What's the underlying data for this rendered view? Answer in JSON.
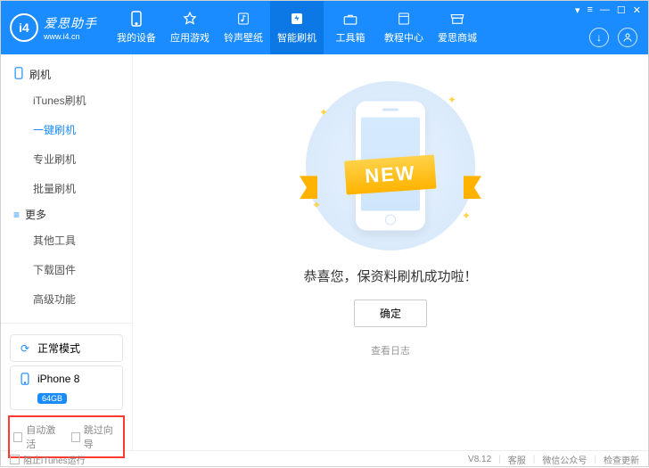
{
  "header": {
    "logo_ch": "爱思助手",
    "logo_en": "www.i4.cn",
    "logo_mark": "i4",
    "nav": [
      {
        "label": "我的设备",
        "icon": "phone"
      },
      {
        "label": "应用游戏",
        "icon": "apps"
      },
      {
        "label": "铃声壁纸",
        "icon": "music"
      },
      {
        "label": "智能刷机",
        "icon": "flash",
        "active": true
      },
      {
        "label": "工具箱",
        "icon": "tools"
      },
      {
        "label": "教程中心",
        "icon": "book"
      },
      {
        "label": "爱思商城",
        "icon": "shop"
      }
    ],
    "win_controls": [
      "▾",
      "≡",
      "—",
      "☐",
      "✕"
    ],
    "download_icon": "download",
    "user_icon": "user"
  },
  "sidebar": {
    "sections": [
      {
        "title": "刷机",
        "icon": "phone-outline",
        "items": [
          "iTunes刷机",
          "一键刷机",
          "专业刷机",
          "批量刷机"
        ],
        "active_index": 1
      },
      {
        "title": "更多",
        "icon": "list",
        "items": [
          "其他工具",
          "下载固件",
          "高级功能"
        ]
      }
    ],
    "mode_card": {
      "icon": "refresh",
      "label": "正常模式"
    },
    "device_card": {
      "icon": "phone",
      "label": "iPhone 8",
      "badge": "64GB"
    },
    "checks": [
      {
        "label": "自动激活"
      },
      {
        "label": "跳过向导"
      }
    ]
  },
  "main": {
    "ribbon_text": "NEW",
    "success_text": "恭喜您，保资料刷机成功啦！",
    "ok_button": "确定",
    "view_log": "查看日志"
  },
  "footer": {
    "itunes_check": "阻止iTunes运行",
    "version": "V8.12",
    "links": [
      "客服",
      "微信公众号",
      "检查更新"
    ]
  }
}
